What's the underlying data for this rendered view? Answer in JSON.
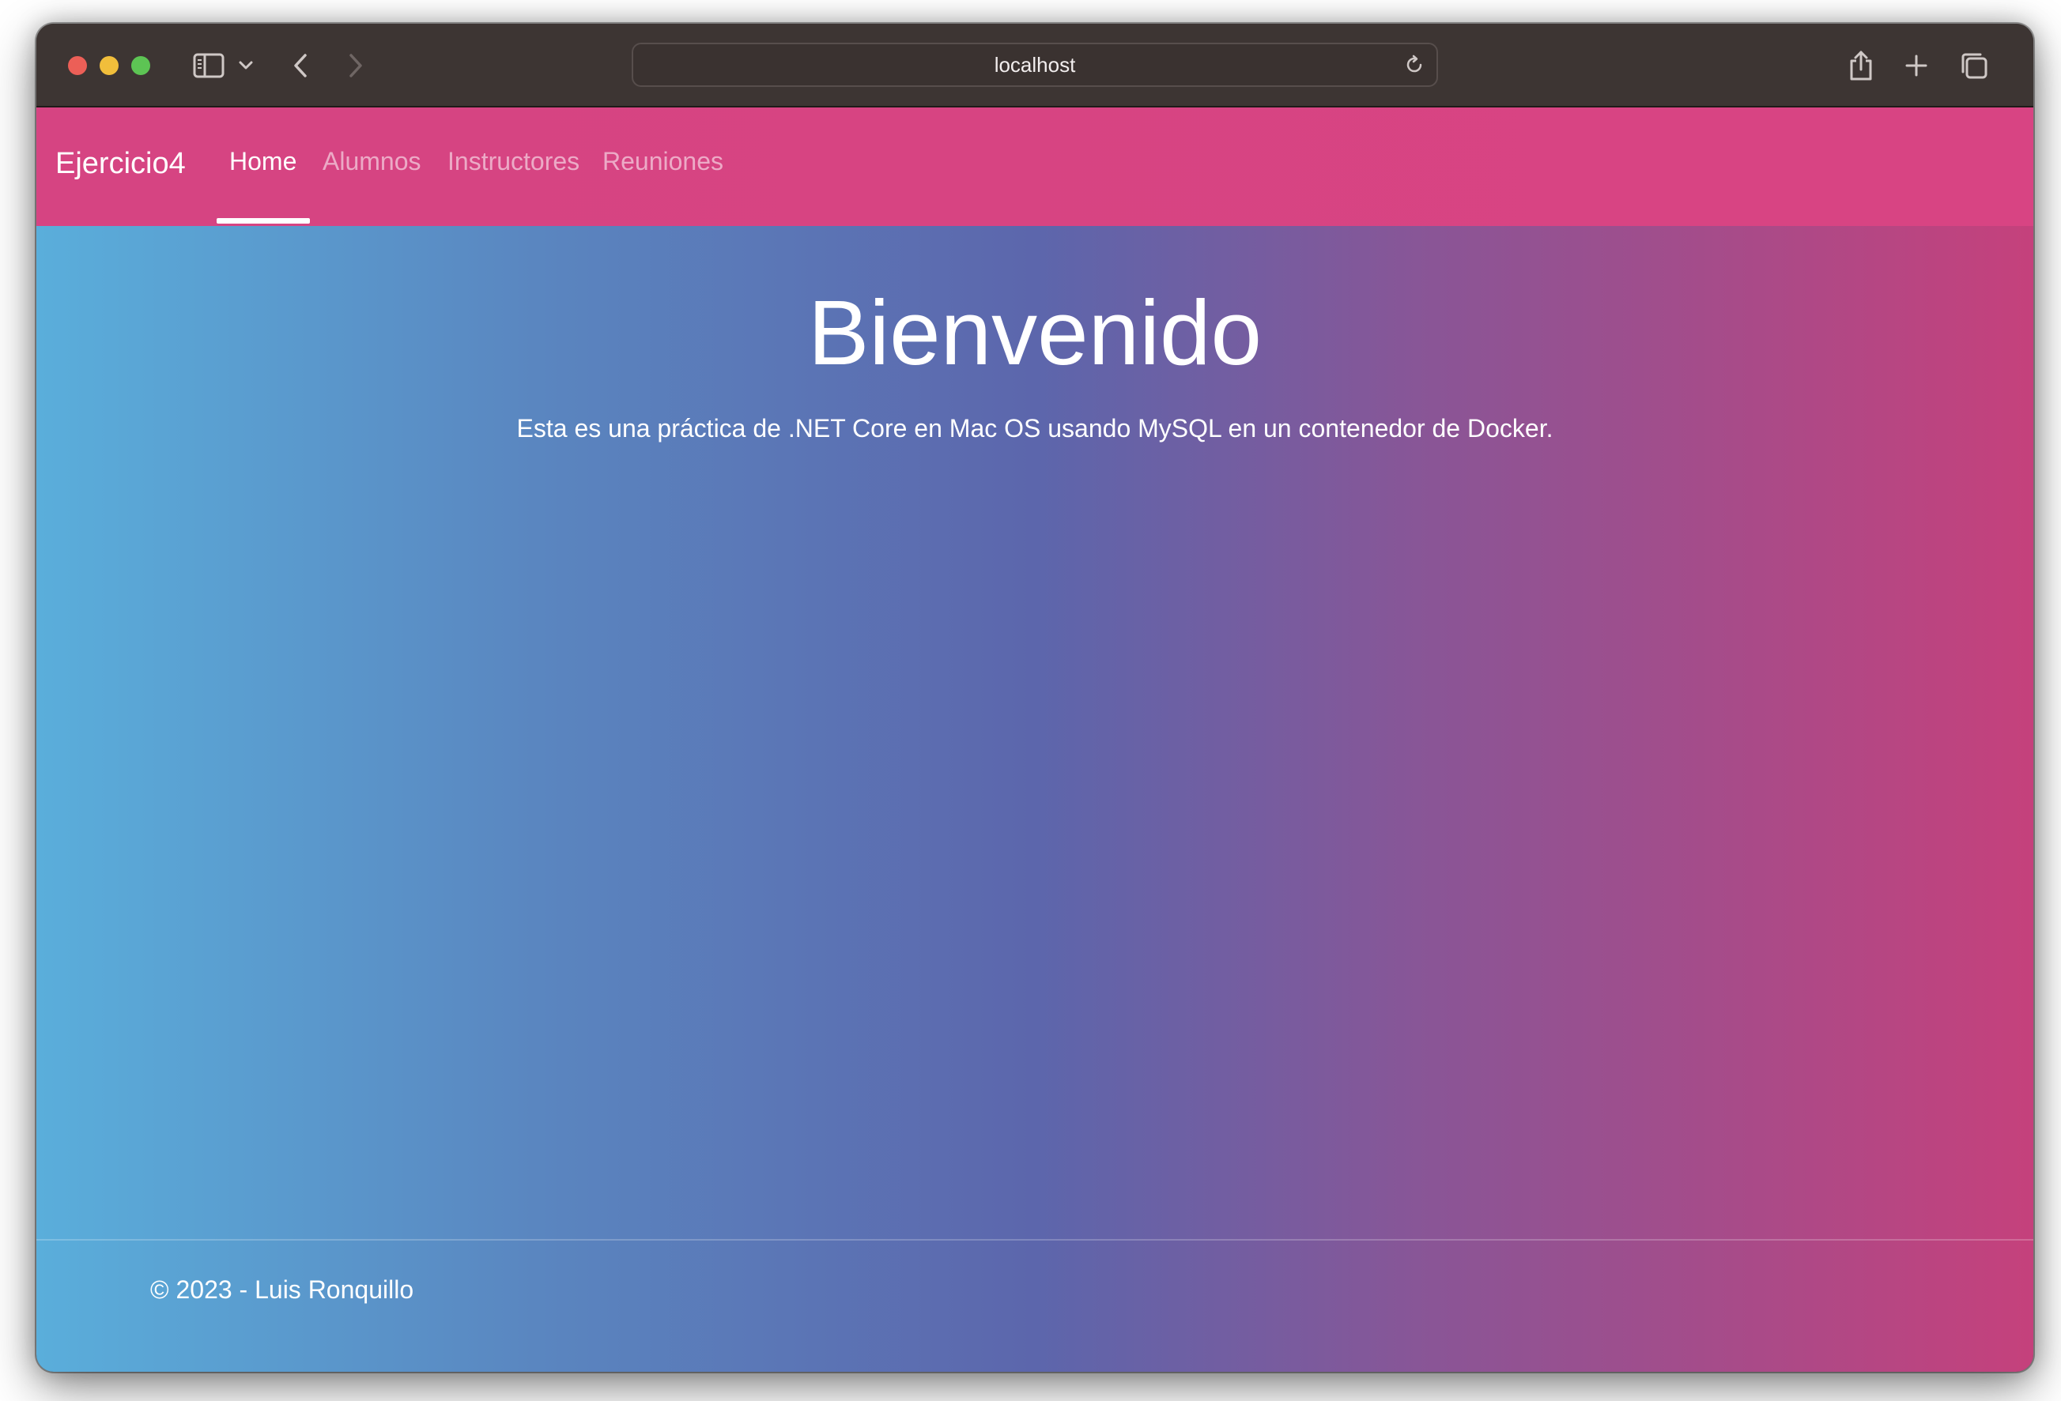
{
  "browser": {
    "url": "localhost",
    "icons": {
      "sidebar": "sidebar-icon",
      "chevron": "chevron-down-icon",
      "back": "back-arrow-icon",
      "forward": "forward-arrow-icon",
      "reload": "reload-icon",
      "share": "share-icon",
      "new_tab": "plus-icon",
      "tabs": "tab-overview-icon"
    }
  },
  "navbar": {
    "brand": "Ejercicio4",
    "items": [
      {
        "label": "Home",
        "active": true
      },
      {
        "label": "Alumnos",
        "active": false
      },
      {
        "label": "Instructores",
        "active": false
      },
      {
        "label": "Reuniones",
        "active": false
      }
    ]
  },
  "main": {
    "title": "Bienvenido",
    "description": "Esta es una práctica de .NET Core en Mac OS usando MySQL en un contenedor de Docker."
  },
  "footer": {
    "text": "© 2023 - Luis Ronquillo"
  },
  "colors": {
    "navbar": "#d74483",
    "gradient_start": "#5aaedb",
    "gradient_mid": "#5c66ac",
    "gradient_end": "#c5417c",
    "toolbar": "#3d3533"
  }
}
